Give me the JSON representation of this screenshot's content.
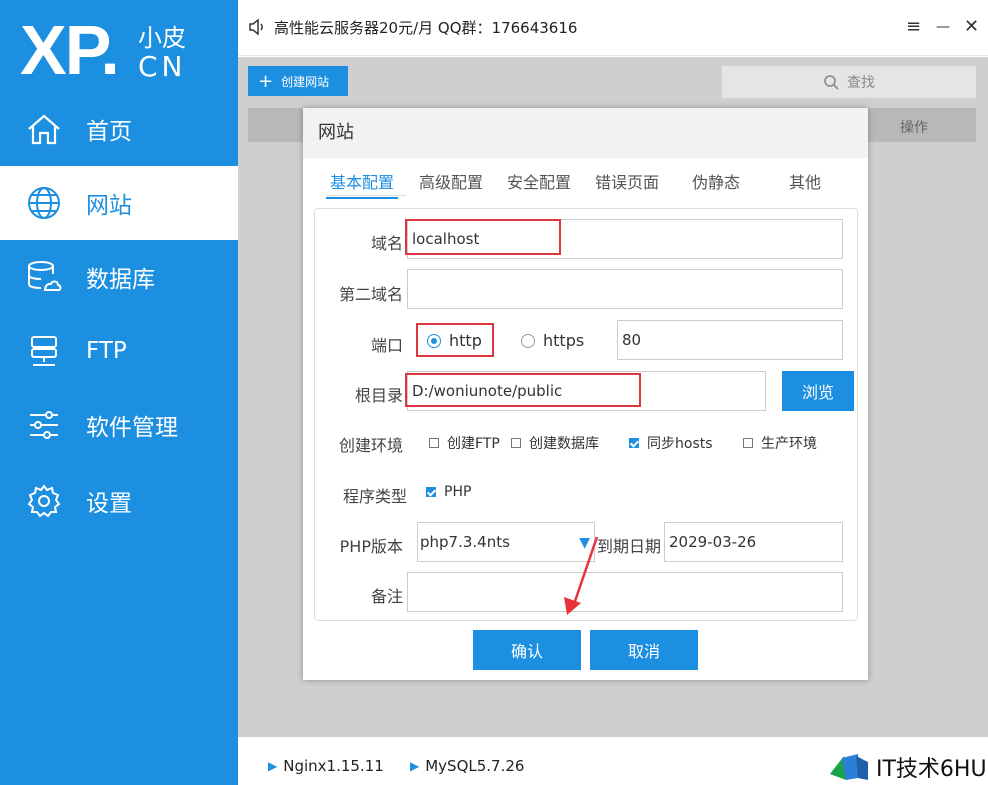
{
  "brand": {
    "xp": "XP.",
    "small": "小皮",
    "cn": "CN"
  },
  "sidebar": {
    "items": [
      {
        "label": "首页",
        "icon": "home-icon"
      },
      {
        "label": "网站",
        "icon": "globe-icon"
      },
      {
        "label": "数据库",
        "icon": "database-icon"
      },
      {
        "label": "FTP",
        "icon": "server-icon"
      },
      {
        "label": "软件管理",
        "icon": "sliders-icon"
      },
      {
        "label": "设置",
        "icon": "gear-icon"
      }
    ],
    "active_index": 1
  },
  "topbar": {
    "announcement": "高性能云服务器20元/月 QQ群：176643616",
    "menu_glyph": "≡",
    "minimize_glyph": "—",
    "close_glyph": "✕"
  },
  "toolbar": {
    "create_label": "创建网站",
    "plus": "+",
    "search_label": "查找"
  },
  "table": {
    "op_header": "操作"
  },
  "dialog": {
    "title": "网站",
    "tabs": [
      "基本配置",
      "高级配置",
      "安全配置",
      "错误页面",
      "伪静态",
      "其他"
    ],
    "active_tab": 0,
    "labels": {
      "domain": "域名",
      "second_domain": "第二域名",
      "port": "端口",
      "root": "根目录",
      "env": "创建环境",
      "prog_type": "程序类型",
      "php_version": "PHP版本",
      "expire": "到期日期",
      "note": "备注"
    },
    "values": {
      "domain": "localhost",
      "second_domain": "",
      "port": "80",
      "root": "D:/woniunote/public",
      "php_version": "php7.3.4nts",
      "expire": "2029-03-26",
      "note": ""
    },
    "protocol": {
      "options": [
        "http",
        "https"
      ],
      "selected": "http"
    },
    "env_options": [
      {
        "label": "创建FTP",
        "checked": false
      },
      {
        "label": "创建数据库",
        "checked": false
      },
      {
        "label": "同步hosts",
        "checked": true
      },
      {
        "label": "生产环境",
        "checked": false
      }
    ],
    "prog_types": [
      {
        "label": "PHP",
        "checked": true
      }
    ],
    "browse_label": "浏览",
    "confirm_label": "确认",
    "cancel_label": "取消"
  },
  "footer": {
    "services": [
      "Nginx1.15.11",
      "MySQL5.7.26"
    ],
    "watermark": "IT技术6HU"
  },
  "colors": {
    "accent": "#1d8fe1",
    "highlight_red": "#d9363e",
    "arrow_red": "#e8323c"
  }
}
